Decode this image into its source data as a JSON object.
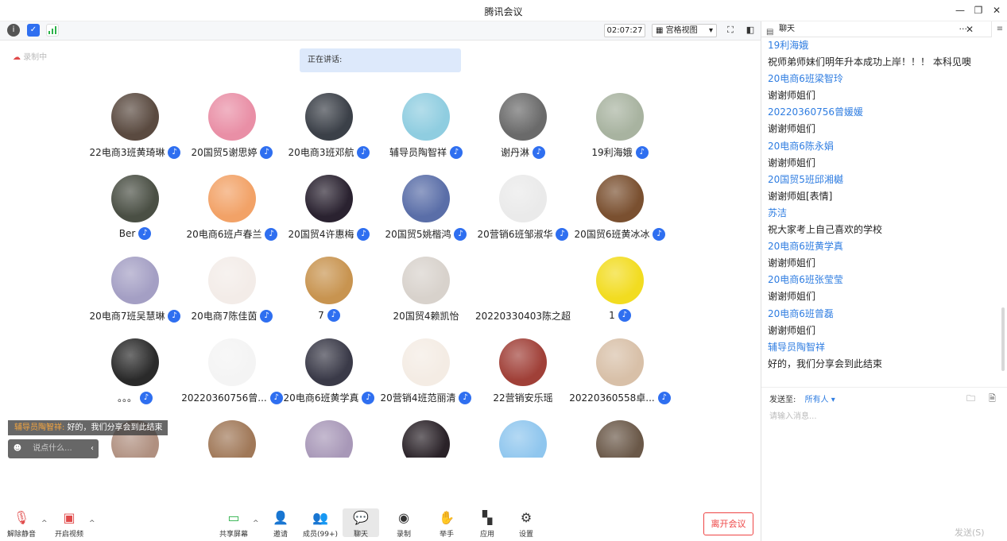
{
  "window": {
    "title": "腾讯会议",
    "minimize": "—",
    "restore": "❐",
    "close": "✕"
  },
  "toolbar": {
    "timer": "02:07:27",
    "view_label": "宫格视图"
  },
  "recording_label": "录制中",
  "speaking_label": "正在讲话:",
  "participants": [
    {
      "name": "22电商3班黄琦琳",
      "mic": true,
      "color": "#5a4a40"
    },
    {
      "name": "20国贸5谢思婷",
      "mic": true,
      "color": "#e98fa6"
    },
    {
      "name": "20电商3班邓航",
      "mic": true,
      "color": "#3b4048"
    },
    {
      "name": "辅导员陶智祥",
      "mic": true,
      "color": "#8fcde0"
    },
    {
      "name": "谢丹淋",
      "mic": true,
      "color": "#6a6a6a"
    },
    {
      "name": "19利海娥",
      "mic": true,
      "color": "#a8b3a0"
    },
    {
      "name": "Ber",
      "mic": true,
      "color": "#4a4f44"
    },
    {
      "name": "20电商6班卢春兰",
      "mic": true,
      "color": "#f2a267"
    },
    {
      "name": "20国贸4许惠梅",
      "mic": true,
      "color": "#2a2230"
    },
    {
      "name": "20国贸5姚楷鸿",
      "mic": true,
      "color": "#5a6ea8"
    },
    {
      "name": "20营销6班邹淑华",
      "mic": true,
      "color": "#eaeaea"
    },
    {
      "name": "20国贸6班黄冰冰",
      "mic": true,
      "color": "#7a5030"
    },
    {
      "name": "20电商7班吴慧琳",
      "mic": true,
      "color": "#a49fc4"
    },
    {
      "name": "20电商7陈佳茵",
      "mic": true,
      "color": "#f3ece8"
    },
    {
      "name": "7",
      "mic": true,
      "color": "#c89450"
    },
    {
      "name": "20国贸4赖凯怡",
      "mic": false,
      "color": "#d8d2cc"
    },
    {
      "name": "20220330403陈之超",
      "mic": false,
      "color": "#ffffff"
    },
    {
      "name": "1",
      "mic": true,
      "color": "#f2dc20"
    },
    {
      "name": "。。。",
      "mic": true,
      "color": "#2a2a2a"
    },
    {
      "name": "20220360756曾...",
      "mic": true,
      "color": "#f4f4f4"
    },
    {
      "name": "20电商6班黄学真",
      "mic": true,
      "color": "#3a3a48"
    },
    {
      "name": "20营销4班范丽清",
      "mic": true,
      "color": "#f4ece4"
    },
    {
      "name": "22营销安乐瑶",
      "mic": false,
      "color": "#a04038"
    },
    {
      "name": "20220360558卓...",
      "mic": true,
      "color": "#d8c0a8"
    },
    {
      "name": "",
      "mic": false,
      "color": "#b09080"
    },
    {
      "name": "",
      "mic": false,
      "color": "#a07858"
    },
    {
      "name": "",
      "mic": false,
      "color": "#a898b8"
    },
    {
      "name": "",
      "mic": false,
      "color": "#2a2228"
    },
    {
      "name": "",
      "mic": false,
      "color": "#8fc6ee"
    },
    {
      "name": "",
      "mic": false,
      "color": "#6a5848"
    }
  ],
  "overlay": {
    "sender": "辅导员陶智祥:",
    "text": "好的，我们分享会到此结束",
    "input_placeholder": "说点什么..."
  },
  "bottom": {
    "unmute": "解除静音",
    "video": "开启视频",
    "share": "共享屏幕",
    "invite": "邀请",
    "members": "成员(99+)",
    "chat": "聊天",
    "record": "录制",
    "raise": "举手",
    "apps": "应用",
    "settings": "设置",
    "leave": "离开会议"
  },
  "chat": {
    "title": "聊天",
    "messages": [
      {
        "sender": "19利海娥",
        "text": "祝师弟师妹们明年升本成功上岸！！！ 本科见噢"
      },
      {
        "sender": "20电商6班梁智玲",
        "text": "谢谢师姐们"
      },
      {
        "sender": "20220360756曾媛媛",
        "text": "谢谢师姐们"
      },
      {
        "sender": "20电商6陈永娟",
        "text": "谢谢师姐们"
      },
      {
        "sender": "20国贸5班邱湘樾",
        "text": "谢谢师姐[表情]"
      },
      {
        "sender": "苏洁",
        "text": "祝大家考上自己喜欢的学校"
      },
      {
        "sender": "20电商6班黄学真",
        "text": "谢谢师姐们"
      },
      {
        "sender": "20电商6班张莹莹",
        "text": "谢谢师姐们"
      },
      {
        "sender": "20电商6班曾磊",
        "text": "谢谢师姐们"
      },
      {
        "sender": "辅导员陶智祥",
        "text": "好的，我们分享会到此结束"
      }
    ],
    "send_to_label": "发送至:",
    "send_to_value": "所有人",
    "input_placeholder": "请输入消息...",
    "send_button": "发送(S)"
  }
}
